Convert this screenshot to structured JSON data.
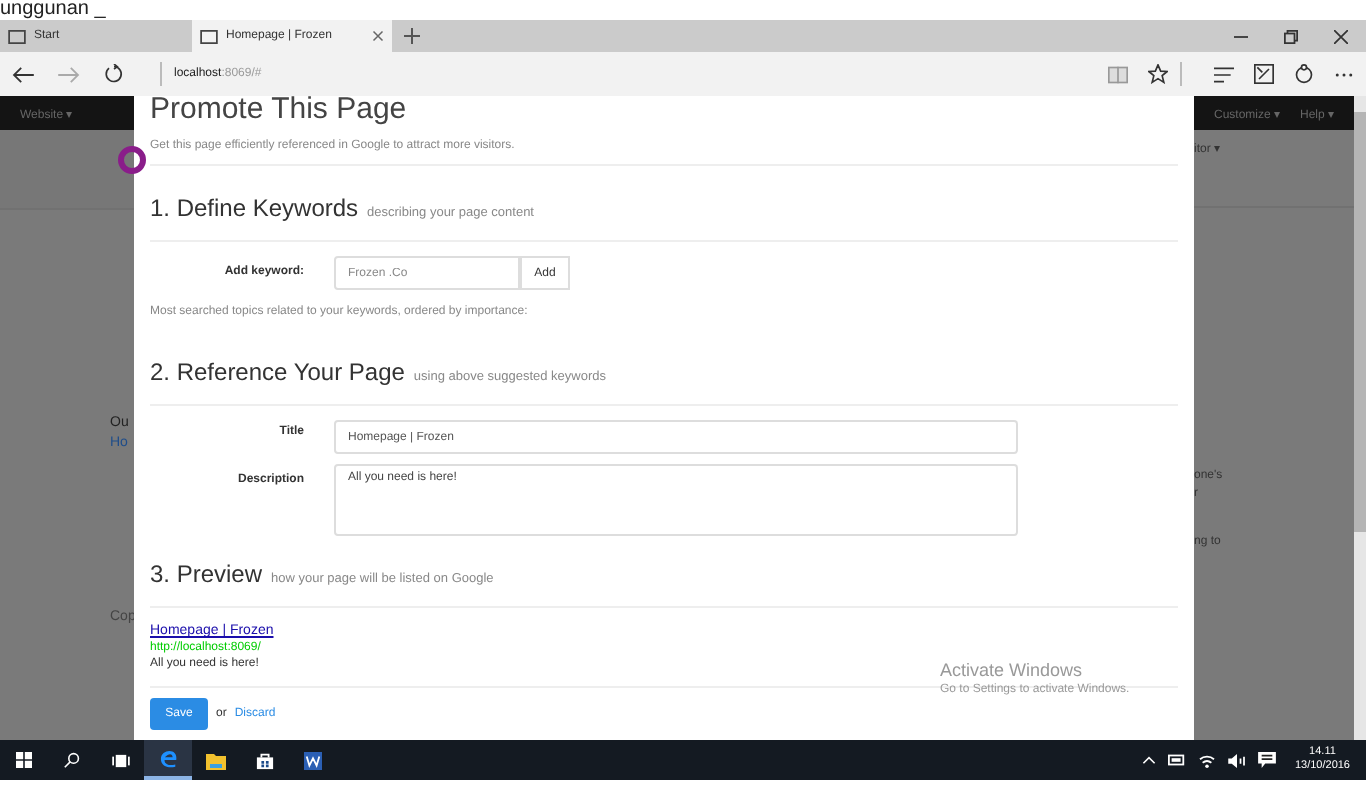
{
  "top_text": "unggunan _",
  "browser": {
    "tabs": [
      {
        "label": "Start",
        "selected": false
      },
      {
        "label": "Homepage | Frozen",
        "selected": true
      }
    ],
    "address": {
      "host": "localhost",
      "rest": ":8069/#"
    }
  },
  "background": {
    "nav_left": "Website ▾",
    "nav_right": [
      "Customize ▾",
      "Help ▾"
    ],
    "left_texts": [
      {
        "text": "Ou",
        "kind": "heading"
      },
      {
        "text": "Ho",
        "kind": "link"
      },
      {
        "text": "Cop",
        "kind": "footer"
      }
    ],
    "right_texts": [
      {
        "text": "itor ▾",
        "kind": "menu"
      },
      {
        "text": "one's",
        "kind": "text"
      },
      {
        "text": "r",
        "kind": "text"
      },
      {
        "text": "ng to",
        "kind": "text"
      }
    ]
  },
  "modal": {
    "title": "Promote This Page",
    "subtitle": "Get this page efficiently referenced in Google to attract more visitors.",
    "keywords": {
      "heading": "1. Define Keywords",
      "hint": "describing your page content",
      "label": "Add keyword:",
      "placeholder": "Frozen .Co",
      "button": "Add",
      "note": "Most searched topics related to your keywords, ordered by importance:"
    },
    "reference": {
      "heading": "2. Reference Your Page",
      "hint": "using above suggested keywords",
      "fields": [
        {
          "label": "Title",
          "value": "Homepage | Frozen",
          "kind": "input"
        },
        {
          "label": "Description",
          "value": "All you need is here!",
          "kind": "textarea"
        }
      ]
    },
    "preview": {
      "heading": "3. Preview",
      "hint": "how your page will be listed on Google",
      "link": "Homepage | Frozen",
      "url": "http://localhost:8069/",
      "description": "All you need is here!"
    },
    "actions": {
      "save": "Save",
      "or": "or",
      "discard": "Discard"
    }
  },
  "activation": {
    "title": "Activate Windows",
    "subtitle": "Go to Settings to activate Windows."
  },
  "taskbar": {
    "apps": [
      {
        "kind": "start",
        "selected": false
      },
      {
        "kind": "search",
        "selected": false
      },
      {
        "kind": "taskview",
        "selected": false
      },
      {
        "kind": "edge",
        "selected": true
      },
      {
        "kind": "explorer",
        "selected": false
      },
      {
        "kind": "store",
        "selected": false
      },
      {
        "kind": "word",
        "selected": false
      }
    ],
    "time": "14.11",
    "date": "13/10/2016"
  }
}
